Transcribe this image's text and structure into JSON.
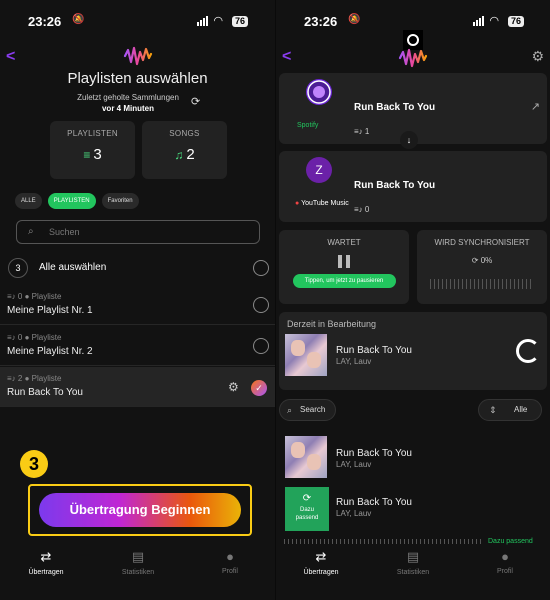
{
  "status_bar": {
    "time": "23:26",
    "battery": "76"
  },
  "left": {
    "title": "Playlisten auswählen",
    "last_fetch_line1": "Zuletzt geholte Sammlungen",
    "last_fetch_line2": "vor 4 Minuten",
    "stats": [
      {
        "label": "PLAYLISTEN",
        "value": "3"
      },
      {
        "label": "SONGS",
        "value": "2"
      }
    ],
    "filters": [
      "ALLE",
      "PLAYLISTEN",
      "Favoriten"
    ],
    "active_filter": "PLAYLISTEN",
    "search_placeholder": "Suchen",
    "select_all": {
      "count": "3",
      "label": "Alle auswählen"
    },
    "playlists": [
      {
        "count": "0",
        "type": "Playliste",
        "name": "Meine Playlist Nr. 1",
        "selected": false
      },
      {
        "count": "0",
        "type": "Playliste",
        "name": "Meine Playlist Nr. 2",
        "selected": false
      },
      {
        "count": "2",
        "type": "Playliste",
        "name": "Run Back To You",
        "selected": true
      }
    ],
    "step_number": "3",
    "start_button": "Übertragung Beginnen"
  },
  "nav": {
    "items": [
      {
        "label": "Übertragen",
        "icon": "transfer-icon",
        "active": true
      },
      {
        "label": "Statistiken",
        "icon": "stats-icon",
        "active": false
      },
      {
        "label": "Profil",
        "icon": "profile-icon",
        "active": false
      }
    ]
  },
  "right": {
    "source": {
      "title": "Run Back To You",
      "service": "Spotify",
      "track_count": "1"
    },
    "target": {
      "avatar_letter": "Z",
      "title": "Run Back To You",
      "service": "YouTube Music",
      "track_count": "0"
    },
    "waiting": {
      "label": "WARTET",
      "button": "Tippen, um jetzt zu pausieren"
    },
    "syncing": {
      "label": "WIRD SYNCHRONISIERT",
      "percent": "0%"
    },
    "editing": {
      "label": "Derzeit in Bearbeitung",
      "song": "Run Back To You",
      "artist": "LAY, Lauv"
    },
    "search_label": "Search",
    "sort_label": "Alle",
    "tracks": [
      {
        "title": "Run Back To You",
        "artist": "LAY, Lauv",
        "badge": ""
      },
      {
        "title": "Run Back To You",
        "artist": "LAY, Lauv",
        "badge": "Dazu passend"
      }
    ],
    "partial_text": "Dazu passend"
  },
  "colors": {
    "accent_purple": "#8a3cf0",
    "green": "#22c55e",
    "highlight_yellow": "#facc15"
  }
}
